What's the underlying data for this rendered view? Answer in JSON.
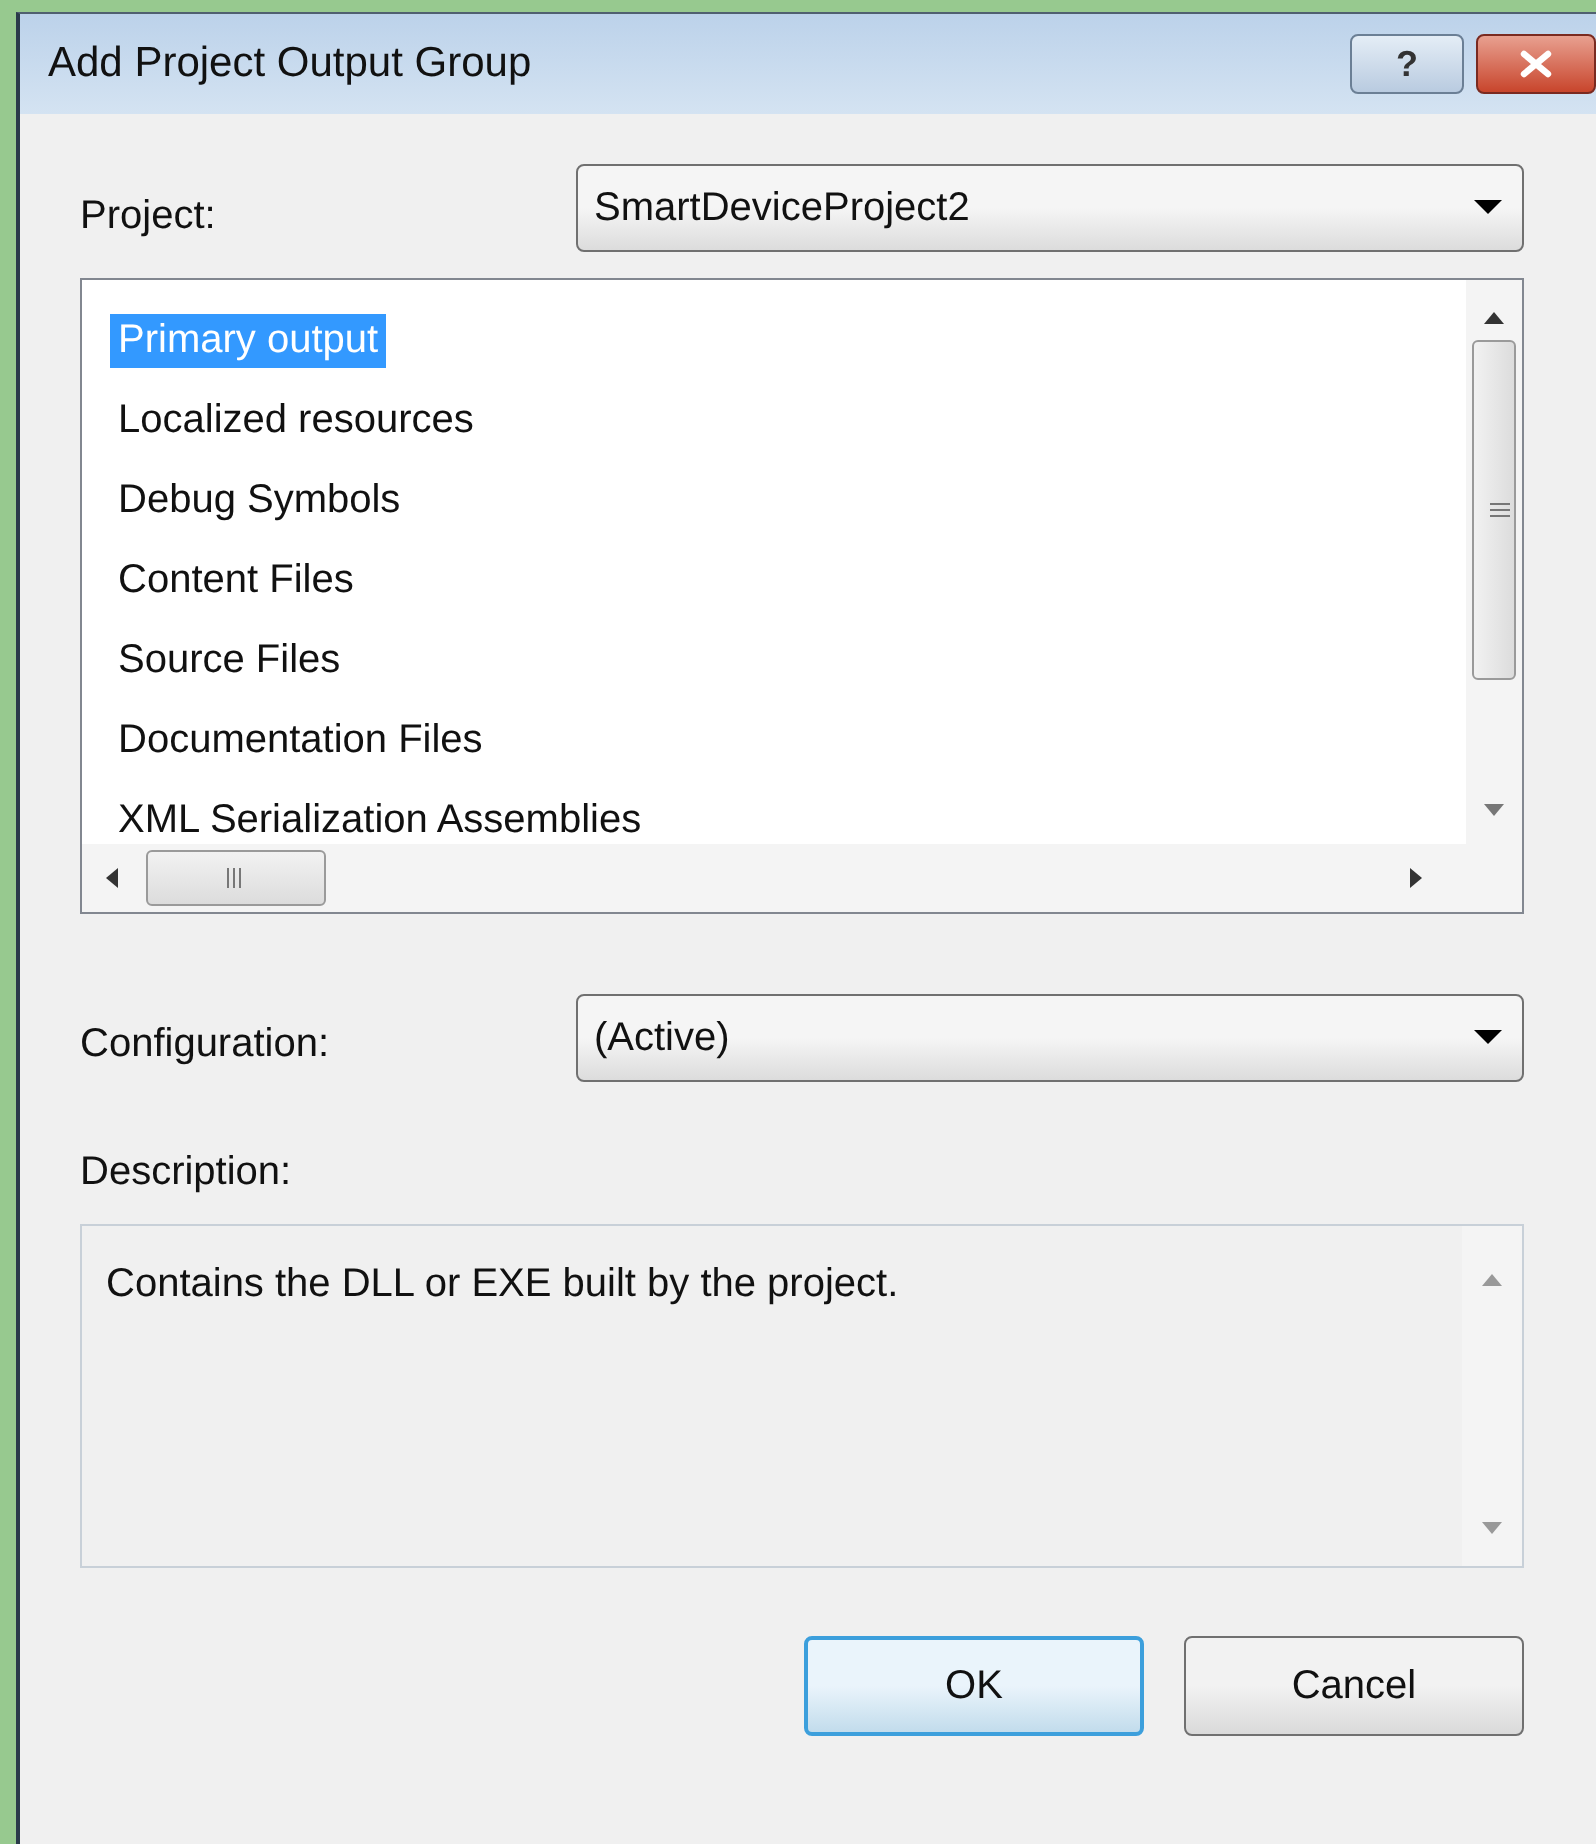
{
  "window": {
    "title": "Add Project Output Group",
    "help_button": "?"
  },
  "project": {
    "label": "Project:",
    "value": "SmartDeviceProject2"
  },
  "outputs": {
    "items": [
      {
        "label": "Primary output",
        "selected": true
      },
      {
        "label": "Localized resources",
        "selected": false
      },
      {
        "label": "Debug Symbols",
        "selected": false
      },
      {
        "label": "Content Files",
        "selected": false
      },
      {
        "label": "Source Files",
        "selected": false
      },
      {
        "label": "Documentation Files",
        "selected": false
      },
      {
        "label": "XML Serialization Assemblies",
        "selected": false
      }
    ]
  },
  "configuration": {
    "label": "Configuration:",
    "value": "(Active)"
  },
  "description": {
    "label": "Description:",
    "text": "Contains the DLL or EXE built by the project."
  },
  "buttons": [
    {
      "label": "OK",
      "default": true
    },
    {
      "label": "Cancel",
      "default": false
    }
  ]
}
